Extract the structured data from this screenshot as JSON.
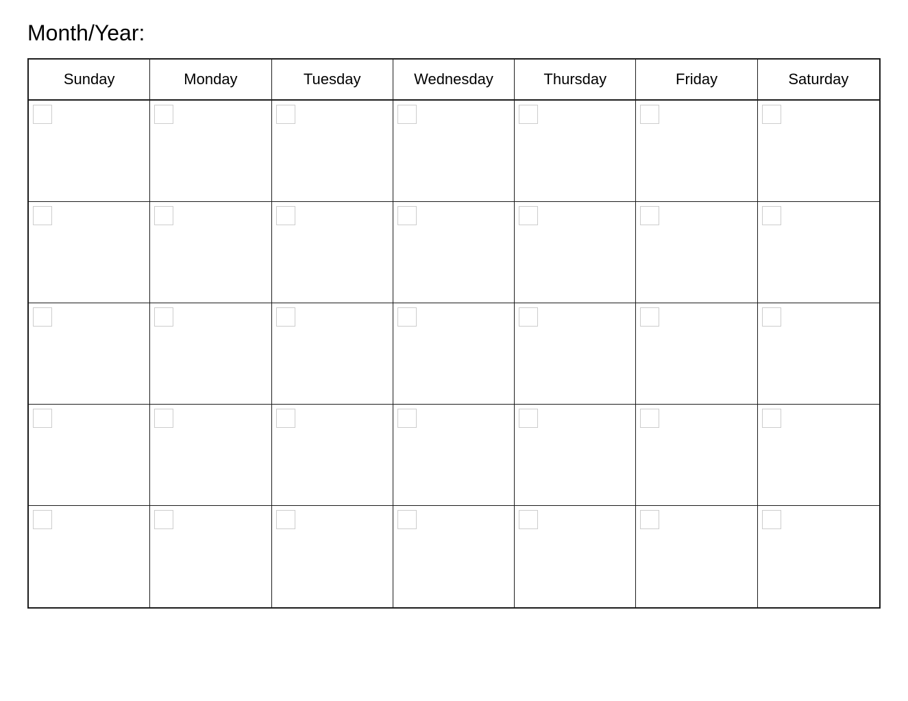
{
  "header": {
    "title": "Month/Year:"
  },
  "calendar": {
    "days": [
      {
        "label": "Sunday"
      },
      {
        "label": "Monday"
      },
      {
        "label": "Tuesday"
      },
      {
        "label": "Wednesday"
      },
      {
        "label": "Thursday"
      },
      {
        "label": "Friday"
      },
      {
        "label": "Saturday"
      }
    ],
    "rows": 5
  }
}
